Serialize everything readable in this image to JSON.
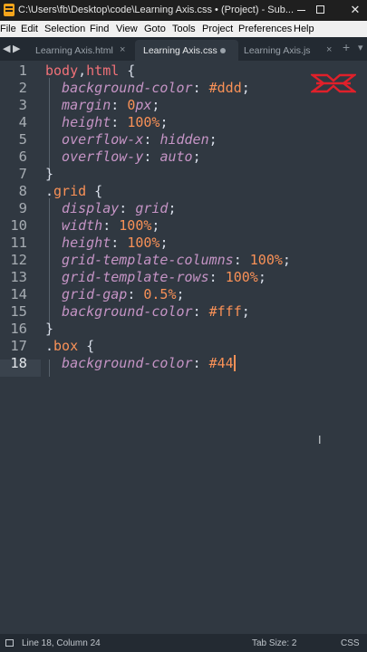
{
  "window": {
    "title": "C:\\Users\\fb\\Desktop\\code\\Learning Axis.css • (Project) - Sub...",
    "min_icon": "minimize-icon",
    "max_icon": "maximize-icon",
    "close_glyph": "✕"
  },
  "menu": [
    "File",
    "Edit",
    "Selection",
    "Find",
    "View",
    "Goto",
    "Tools",
    "Project",
    "Preferences",
    "Help"
  ],
  "tabs": {
    "items": [
      {
        "label": "Learning Axis.html",
        "state": "inactive",
        "close": "×"
      },
      {
        "label": "Learning Axis.css",
        "state": "active",
        "dirty": true
      },
      {
        "label": "Learning Axis.js",
        "state": "inactive",
        "close": "×"
      }
    ],
    "nav_left": "◀",
    "nav_right": "▶",
    "plus": "+",
    "chevron": "▾"
  },
  "editor": {
    "current_line": 18,
    "lines": [
      {
        "n": "1",
        "tokens": [
          [
            "sel",
            "body"
          ],
          [
            "comma",
            ","
          ],
          [
            "sel",
            "html"
          ],
          [
            "brace",
            " {"
          ]
        ]
      },
      {
        "n": "2",
        "tokens": [
          [
            "prop",
            "  background-color"
          ],
          [
            "colon",
            ": "
          ],
          [
            "hash",
            "#ddd"
          ],
          [
            "semi",
            ";"
          ]
        ]
      },
      {
        "n": "3",
        "tokens": [
          [
            "prop",
            "  margin"
          ],
          [
            "colon",
            ": "
          ],
          [
            "val",
            "0"
          ],
          [
            "unit",
            "px"
          ],
          [
            "semi",
            ";"
          ]
        ]
      },
      {
        "n": "4",
        "tokens": [
          [
            "prop",
            "  height"
          ],
          [
            "colon",
            ": "
          ],
          [
            "val",
            "100"
          ],
          [
            "pct",
            "%"
          ],
          [
            "semi",
            ";"
          ]
        ]
      },
      {
        "n": "5",
        "tokens": [
          [
            "prop",
            "  overflow-x"
          ],
          [
            "colon",
            ": "
          ],
          [
            "kw",
            "hidden"
          ],
          [
            "semi",
            ";"
          ]
        ]
      },
      {
        "n": "6",
        "tokens": [
          [
            "prop",
            "  overflow-y"
          ],
          [
            "colon",
            ": "
          ],
          [
            "kw",
            "auto"
          ],
          [
            "semi",
            ";"
          ]
        ]
      },
      {
        "n": "7",
        "tokens": [
          [
            "brace",
            "}"
          ]
        ]
      },
      {
        "n": "8",
        "tokens": [
          [
            "brace",
            "."
          ],
          [
            "class",
            "grid"
          ],
          [
            "brace",
            " {"
          ]
        ]
      },
      {
        "n": "9",
        "tokens": [
          [
            "prop",
            "  display"
          ],
          [
            "colon",
            ": "
          ],
          [
            "kw",
            "grid"
          ],
          [
            "semi",
            ";"
          ]
        ]
      },
      {
        "n": "10",
        "tokens": [
          [
            "prop",
            "  width"
          ],
          [
            "colon",
            ": "
          ],
          [
            "val",
            "100"
          ],
          [
            "pct",
            "%"
          ],
          [
            "semi",
            ";"
          ]
        ]
      },
      {
        "n": "11",
        "tokens": [
          [
            "prop",
            "  height"
          ],
          [
            "colon",
            ": "
          ],
          [
            "val",
            "100"
          ],
          [
            "pct",
            "%"
          ],
          [
            "semi",
            ";"
          ]
        ]
      },
      {
        "n": "12",
        "tokens": [
          [
            "prop",
            "  grid-template-columns"
          ],
          [
            "colon",
            ": "
          ],
          [
            "val",
            "100"
          ],
          [
            "pct",
            "%"
          ],
          [
            "semi",
            ";"
          ]
        ]
      },
      {
        "n": "13",
        "tokens": [
          [
            "prop",
            "  grid-template-rows"
          ],
          [
            "colon",
            ": "
          ],
          [
            "val",
            "100"
          ],
          [
            "pct",
            "%"
          ],
          [
            "semi",
            ";"
          ]
        ]
      },
      {
        "n": "14",
        "tokens": [
          [
            "prop",
            "  grid-gap"
          ],
          [
            "colon",
            ": "
          ],
          [
            "val",
            "0.5"
          ],
          [
            "pct",
            "%"
          ],
          [
            "semi",
            ";"
          ]
        ]
      },
      {
        "n": "15",
        "tokens": [
          [
            "prop",
            "  background-color"
          ],
          [
            "colon",
            ": "
          ],
          [
            "hash",
            "#fff"
          ],
          [
            "semi",
            ";"
          ]
        ]
      },
      {
        "n": "16",
        "tokens": [
          [
            "brace",
            "}"
          ]
        ]
      },
      {
        "n": "17",
        "tokens": [
          [
            "brace",
            "."
          ],
          [
            "class",
            "box"
          ],
          [
            "brace",
            " {"
          ]
        ]
      },
      {
        "n": "18",
        "tokens": [
          [
            "prop",
            "  background-color"
          ],
          [
            "colon",
            ": "
          ],
          [
            "hash",
            "#44"
          ]
        ],
        "cursor": true
      }
    ]
  },
  "overlay": {
    "logo_icon": "brand-logo-icon",
    "logo_color": "#e0202a",
    "ibeam_glyph": "I"
  },
  "status": {
    "position": "Line 18, Column 24",
    "tab_size": "Tab Size: 2",
    "syntax": "CSS"
  },
  "colors": {
    "editor_bg": "#303841",
    "selector": "#f07178",
    "property": "#c594c5",
    "value": "#f99157"
  }
}
